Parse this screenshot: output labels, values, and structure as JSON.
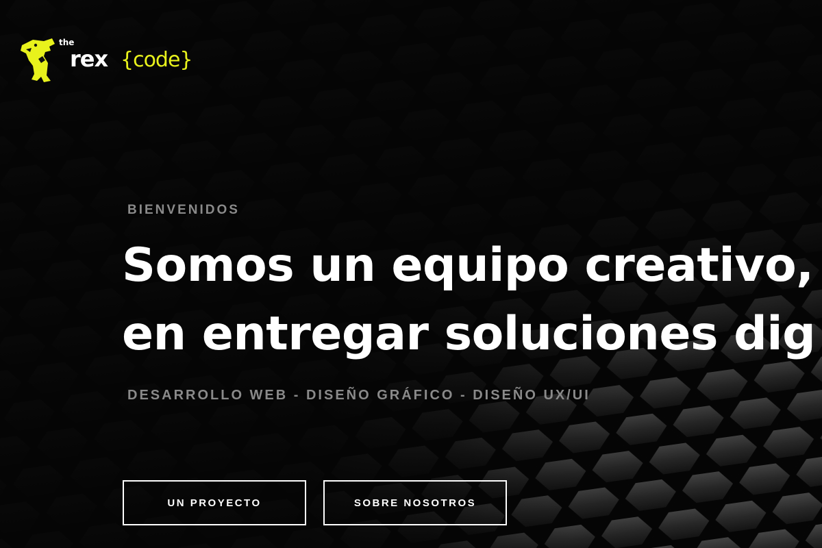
{
  "logo": {
    "the": "the",
    "rex": "rex",
    "code": "{code}",
    "accent_color": "#e8f21c",
    "mascot_icon": "t-rex-icon"
  },
  "hero": {
    "eyebrow": "BIENVENIDOS",
    "headline_line1": "Somos un equipo creativo,",
    "headline_line2": "en entregar soluciones dig",
    "services": "DESARROLLO WEB - DISEÑO GRÁFICO - DISEÑO UX/UI",
    "background": "hexagon-pattern"
  },
  "buttons": {
    "project_label": "UN PROYECTO",
    "about_label": "SOBRE NOSOTROS"
  }
}
